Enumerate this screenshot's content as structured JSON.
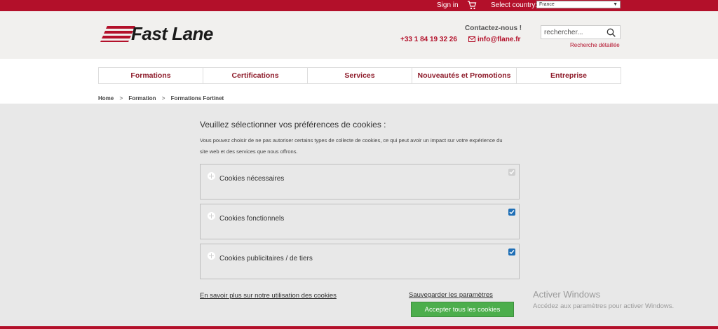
{
  "topbar": {
    "sign_in": "Sign in",
    "cart_icon": "cart-icon",
    "country_label": "Select country:",
    "country_value": "France",
    "color": "#b3102a"
  },
  "header": {
    "logo_text": "Fast Lane",
    "contact_title": "Contactez-nous !",
    "phone": "+33 1 84 19 32 26",
    "email": "info@flane.fr",
    "search_placeholder": "rechercher...",
    "advanced_search": "Recherche détaillée"
  },
  "nav": {
    "items": [
      "Formations",
      "Certifications",
      "Services",
      "Nouveautés et Promotions",
      "Entreprise"
    ]
  },
  "breadcrumb": {
    "items": [
      "Home",
      "Formation",
      "Formations Fortinet"
    ],
    "separator": ">"
  },
  "cookie_dialog": {
    "title": "Veuillez sélectionner vos préférences de cookies :",
    "description": "Vous pouvez choisir de ne pas autoriser certains types de collecte de cookies, ce qui peut avoir un impact sur votre expérience du site web et des services que nous offrons.",
    "categories": [
      {
        "label": "Cookies nécessaires",
        "checked": true,
        "disabled": true
      },
      {
        "label": "Cookies fonctionnels",
        "checked": true,
        "disabled": false
      },
      {
        "label": "Cookies publicitaires / de tiers",
        "checked": true,
        "disabled": false
      }
    ],
    "learn_more": "En savoir plus sur notre utilisation des cookies",
    "save_settings": "Sauvegarder les paramètres",
    "accept_all": "Accepter tous les cookies"
  },
  "windows_watermark": {
    "title": "Activer Windows",
    "subtitle": "Accédez aux paramètres pour activer Windows."
  }
}
